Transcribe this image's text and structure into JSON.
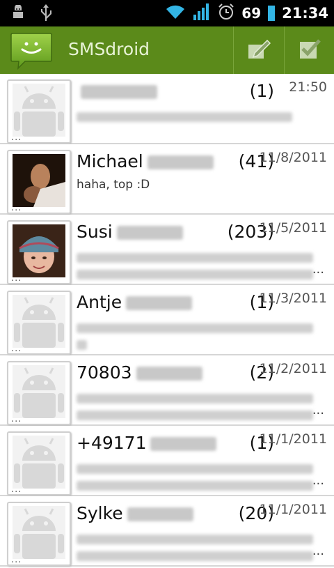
{
  "status_bar": {
    "left_icons": [
      "android-debug-icon",
      "usb-icon"
    ],
    "right_icons": [
      "wifi-icon",
      "signal-icon",
      "alarm-icon"
    ],
    "battery_level": "69",
    "time": "21:34",
    "battery_color": "#33b5e5"
  },
  "action_bar": {
    "title": "SMSdroid",
    "background": "#5b8a1a",
    "actions": [
      "compose-icon",
      "mark-all-read-icon"
    ]
  },
  "threads": [
    {
      "name": "",
      "count": "(1)",
      "date": "21:50",
      "avatar": "android-default",
      "preview": "",
      "preview_lines": 1,
      "truncated": false
    },
    {
      "name": "Michael",
      "count": "(41)",
      "date": "11/8/2011",
      "avatar": "photo-michael",
      "preview": "haha, top :D",
      "preview_lines": 0,
      "truncated": false
    },
    {
      "name": "Susi",
      "count": "(203)",
      "date": "11/5/2011",
      "avatar": "photo-susi",
      "preview": "",
      "preview_lines": 2,
      "truncated": true
    },
    {
      "name": "Antje",
      "count": "(1)",
      "date": "11/3/2011",
      "avatar": "android-default",
      "preview": "",
      "preview_lines": 2,
      "truncated": false
    },
    {
      "name": "70803",
      "count": "(2)",
      "date": "11/2/2011",
      "avatar": "android-default",
      "preview": "",
      "preview_lines": 2,
      "truncated": true
    },
    {
      "name": "+49171",
      "count": "(1)",
      "date": "11/1/2011",
      "avatar": "android-default",
      "preview": "",
      "preview_lines": 2,
      "truncated": true
    },
    {
      "name": "Sylke",
      "count": "(20)",
      "date": "11/1/2011",
      "avatar": "android-default",
      "preview": "",
      "preview_lines": 2,
      "truncated": true
    }
  ],
  "avatar_more_label": "...",
  "ellipsis": "..."
}
